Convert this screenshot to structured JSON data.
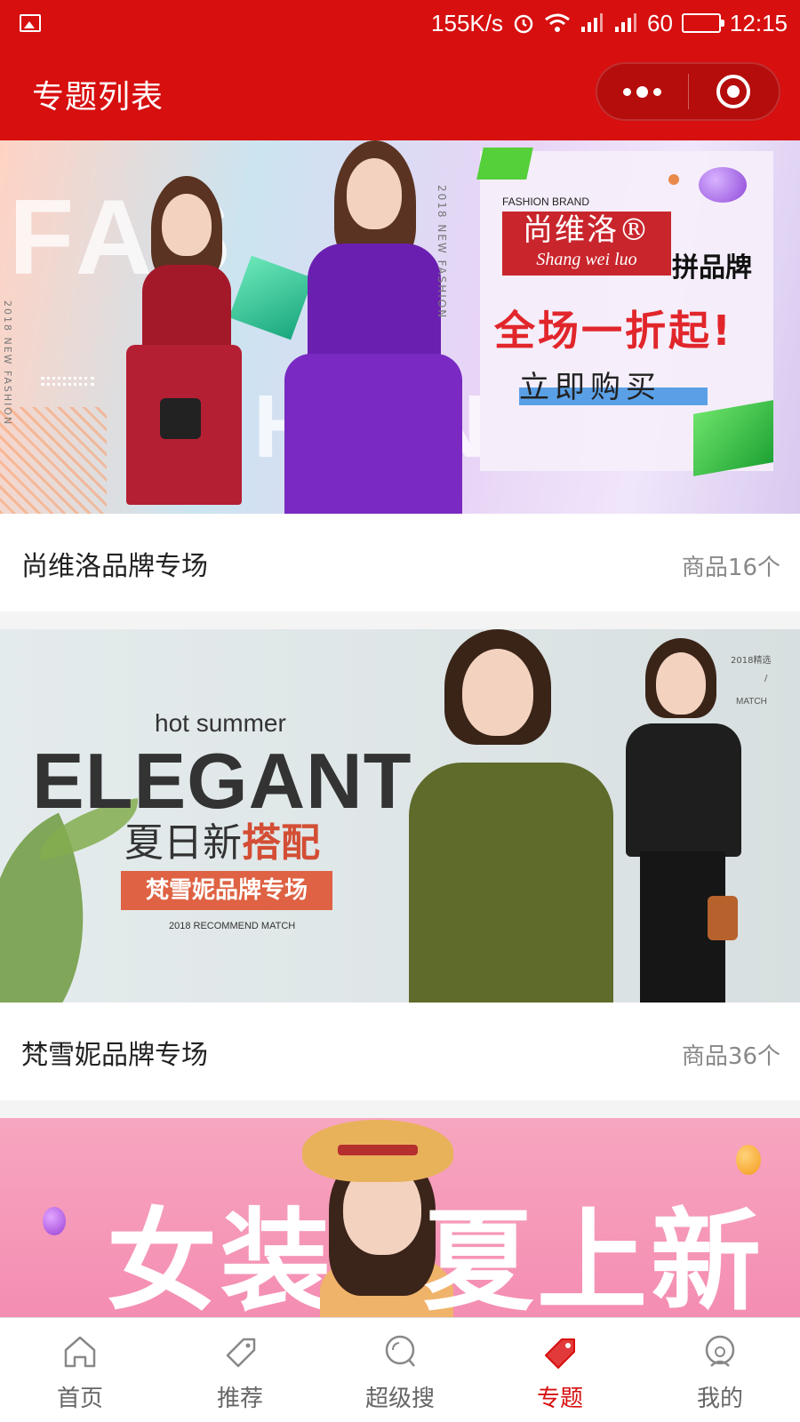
{
  "status_bar": {
    "network_speed": "155K/s",
    "battery_level": "60",
    "time": "12:15"
  },
  "header": {
    "title": "专题列表"
  },
  "topics": [
    {
      "name": "尚维洛品牌专场",
      "count_label": "商品16个",
      "banner": {
        "bg_word_top": "FAS",
        "bg_word_bottom": "HON",
        "vertical_tag": "2018 NEW FASHION",
        "fashion_brand": "FASHION BRAND",
        "logo_cn": "尚维洛®",
        "logo_en": "Shang wei luo",
        "pin_brand": "拼品牌",
        "sale": "全场一折起!",
        "buy": "立即购买"
      }
    },
    {
      "name": "梵雪妮品牌专场",
      "count_label": "商品36个",
      "banner": {
        "hot_summer": "hot summer",
        "elegant": "ELEGANT",
        "cn_line_plain": "夏日新",
        "cn_line_accent": "搭配",
        "tag": "梵雪妮品牌专场",
        "recommend": "2018 RECOMMEND MATCH",
        "side_year": "2018精选",
        "side_slash": "/",
        "side_match": "MATCH"
      }
    },
    {
      "banner": {
        "left_text": "女装",
        "right_text": "夏上新"
      }
    }
  ],
  "tab_bar": {
    "items": [
      {
        "label": "首页",
        "icon": "home-icon"
      },
      {
        "label": "推荐",
        "icon": "tag-icon"
      },
      {
        "label": "超级搜",
        "icon": "search-bubble-icon"
      },
      {
        "label": "专题",
        "icon": "topic-tag-icon"
      },
      {
        "label": "我的",
        "icon": "profile-icon"
      }
    ],
    "active_index": 3,
    "active_color": "#d70f0f"
  },
  "colors": {
    "brand_red": "#d70f0f"
  }
}
